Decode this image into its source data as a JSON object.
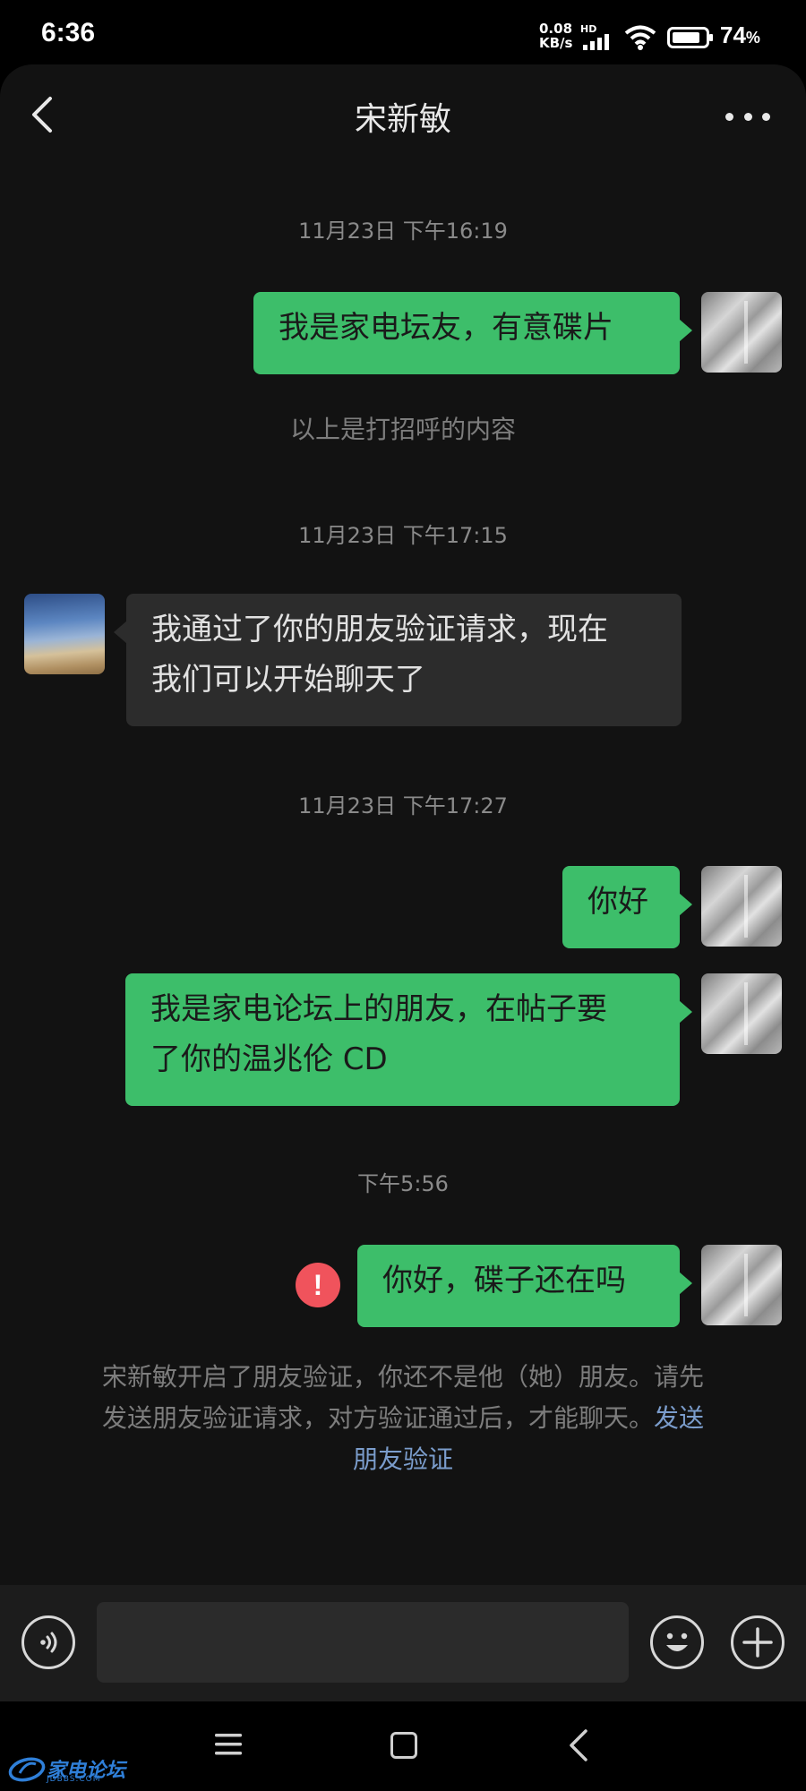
{
  "status_bar": {
    "time": "6:36",
    "net_speed": "0.08",
    "net_unit": "KB/s",
    "hd": "HD",
    "battery": "74",
    "battery_unit": "%"
  },
  "header": {
    "title": "宋新敏"
  },
  "messages": [
    {
      "kind": "timestamp",
      "text": "11月23日 下午16:19"
    },
    {
      "kind": "bubble",
      "side": "me",
      "text": "我是家电坛友，有意碟片"
    },
    {
      "kind": "system",
      "text": "以上是打招呼的内容"
    },
    {
      "kind": "timestamp",
      "text": "11月23日 下午17:15"
    },
    {
      "kind": "bubble",
      "side": "peer",
      "line1": "我通过了你的朋友验证请求，现在",
      "line2": "我们可以开始聊天了"
    },
    {
      "kind": "timestamp",
      "text": "11月23日 下午17:27"
    },
    {
      "kind": "bubble",
      "side": "me",
      "text": "你好"
    },
    {
      "kind": "bubble",
      "side": "me",
      "line1": "我是家电论坛上的朋友，在帖子要",
      "line2": "了你的温兆伦 CD"
    },
    {
      "kind": "timestamp",
      "text": "下午5:56"
    },
    {
      "kind": "bubble",
      "side": "me",
      "text": "你好，碟子还在吗",
      "failed": true,
      "fail_mark": "!"
    }
  ],
  "notice": {
    "line1": "宋新敏开启了朋友验证，你还不是他（她）朋友。请先",
    "line2_text": "发送朋友验证请求，对方验证通过后，才能聊天。",
    "line2_link": "发送",
    "line3_link": "朋友验证"
  },
  "input": {
    "placeholder": ""
  },
  "watermark": {
    "text": "家电论坛",
    "sub": "JDBBS.COM"
  },
  "colors": {
    "bubble_me": "#3dbe6a",
    "bubble_peer": "#2c2c2c",
    "background": "#121212",
    "link": "#7b9dcc",
    "error": "#f0535c"
  }
}
